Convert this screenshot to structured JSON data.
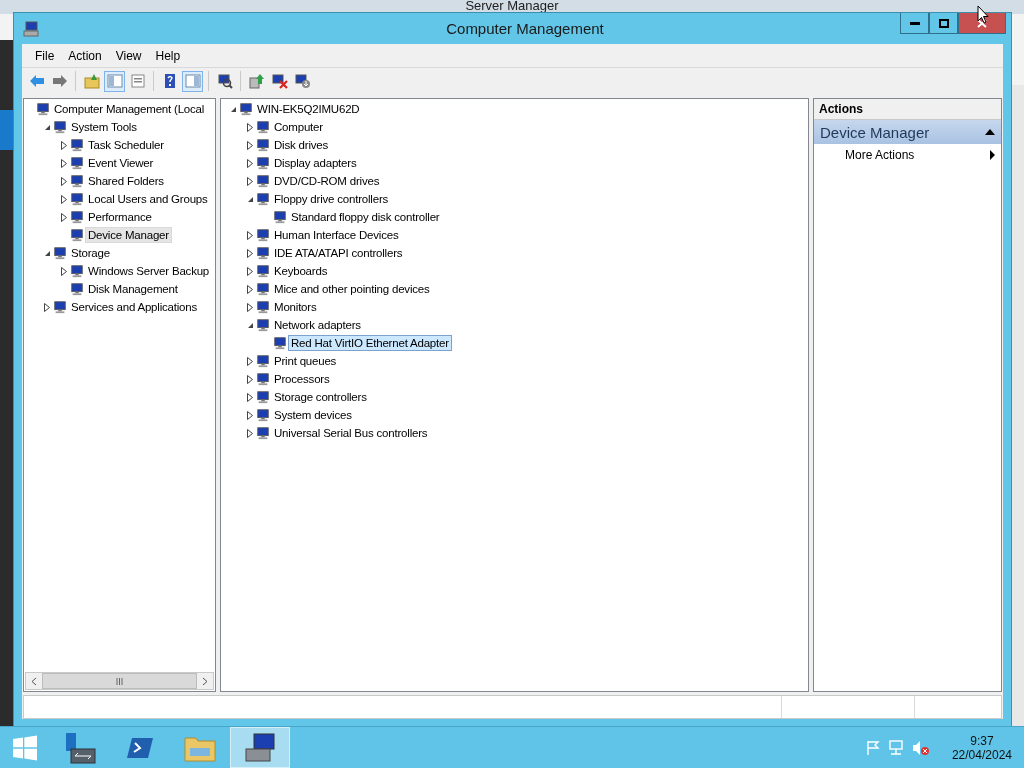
{
  "background_window": {
    "title": "Server Manager"
  },
  "window": {
    "title": "Computer Management"
  },
  "menu": [
    "File",
    "Action",
    "View",
    "Help"
  ],
  "toolbar": [
    {
      "kind": "button",
      "on": false
    },
    {
      "kind": "button",
      "on": false
    },
    {
      "kind": "separator"
    },
    {
      "kind": "button",
      "on": false
    },
    {
      "kind": "button",
      "on": true
    },
    {
      "kind": "button",
      "on": false
    },
    {
      "kind": "separator"
    },
    {
      "kind": "button",
      "on": false
    },
    {
      "kind": "button",
      "on": true
    },
    {
      "kind": "separator"
    },
    {
      "kind": "button",
      "on": false
    },
    {
      "kind": "separator"
    },
    {
      "kind": "button",
      "on": false
    },
    {
      "kind": "button",
      "on": false
    },
    {
      "kind": "button",
      "on": false
    }
  ],
  "console_tree": [
    {
      "label": "Computer Management (Local",
      "selected": false,
      "children": [
        {
          "label": "System Tools",
          "expanded": true,
          "selected": false,
          "children": [
            {
              "label": "Task Scheduler",
              "expanded": false,
              "selected": false
            },
            {
              "label": "Event Viewer",
              "expanded": false,
              "selected": false
            },
            {
              "label": "Shared Folders",
              "expanded": false,
              "selected": false
            },
            {
              "label": "Local Users and Groups",
              "expanded": false,
              "selected": false
            },
            {
              "label": "Performance",
              "expanded": false,
              "selected": false
            },
            {
              "label": "Device Manager",
              "selected": true
            }
          ]
        },
        {
          "label": "Storage",
          "expanded": true,
          "selected": false,
          "children": [
            {
              "label": "Windows Server Backup",
              "expanded": false,
              "selected": false
            },
            {
              "label": "Disk Management",
              "selected": false
            }
          ]
        },
        {
          "label": "Services and Applications",
          "expanded": false,
          "selected": false
        }
      ]
    }
  ],
  "device_tree": [
    {
      "label": "WIN-EK5Q2IMU62D",
      "expanded": true,
      "selected": false,
      "children": [
        {
          "label": "Computer",
          "expanded": false,
          "selected": false
        },
        {
          "label": "Disk drives",
          "expanded": false,
          "selected": false
        },
        {
          "label": "Display adapters",
          "expanded": false,
          "selected": false
        },
        {
          "label": "DVD/CD-ROM drives",
          "expanded": false,
          "selected": false
        },
        {
          "label": "Floppy drive controllers",
          "expanded": true,
          "selected": false,
          "children": [
            {
              "label": "Standard floppy disk controller",
              "selected": false
            }
          ]
        },
        {
          "label": "Human Interface Devices",
          "expanded": false,
          "selected": false
        },
        {
          "label": "IDE ATA/ATAPI controllers",
          "expanded": false,
          "selected": false
        },
        {
          "label": "Keyboards",
          "expanded": false,
          "selected": false
        },
        {
          "label": "Mice and other pointing devices",
          "expanded": false,
          "selected": false
        },
        {
          "label": "Monitors",
          "expanded": false,
          "selected": false
        },
        {
          "label": "Network adapters",
          "expanded": true,
          "selected": false,
          "children": [
            {
              "label": "Red Hat VirtIO Ethernet Adapter",
              "selected": true
            }
          ]
        },
        {
          "label": "Print queues",
          "expanded": false,
          "selected": false
        },
        {
          "label": "Processors",
          "expanded": false,
          "selected": false
        },
        {
          "label": "Storage controllers",
          "expanded": false,
          "selected": false
        },
        {
          "label": "System devices",
          "expanded": false,
          "selected": false
        },
        {
          "label": "Universal Serial Bus controllers",
          "expanded": false,
          "selected": false
        }
      ]
    }
  ],
  "actions": {
    "title": "Actions",
    "section": {
      "title": "Device Manager",
      "expanded": true
    },
    "items": [
      "More Actions"
    ]
  },
  "taskbar": {
    "apps": [
      {
        "selected": false
      },
      {
        "selected": false
      },
      {
        "selected": false
      },
      {
        "selected": true
      }
    ],
    "time": "9:37",
    "date": "22/04/2024"
  }
}
